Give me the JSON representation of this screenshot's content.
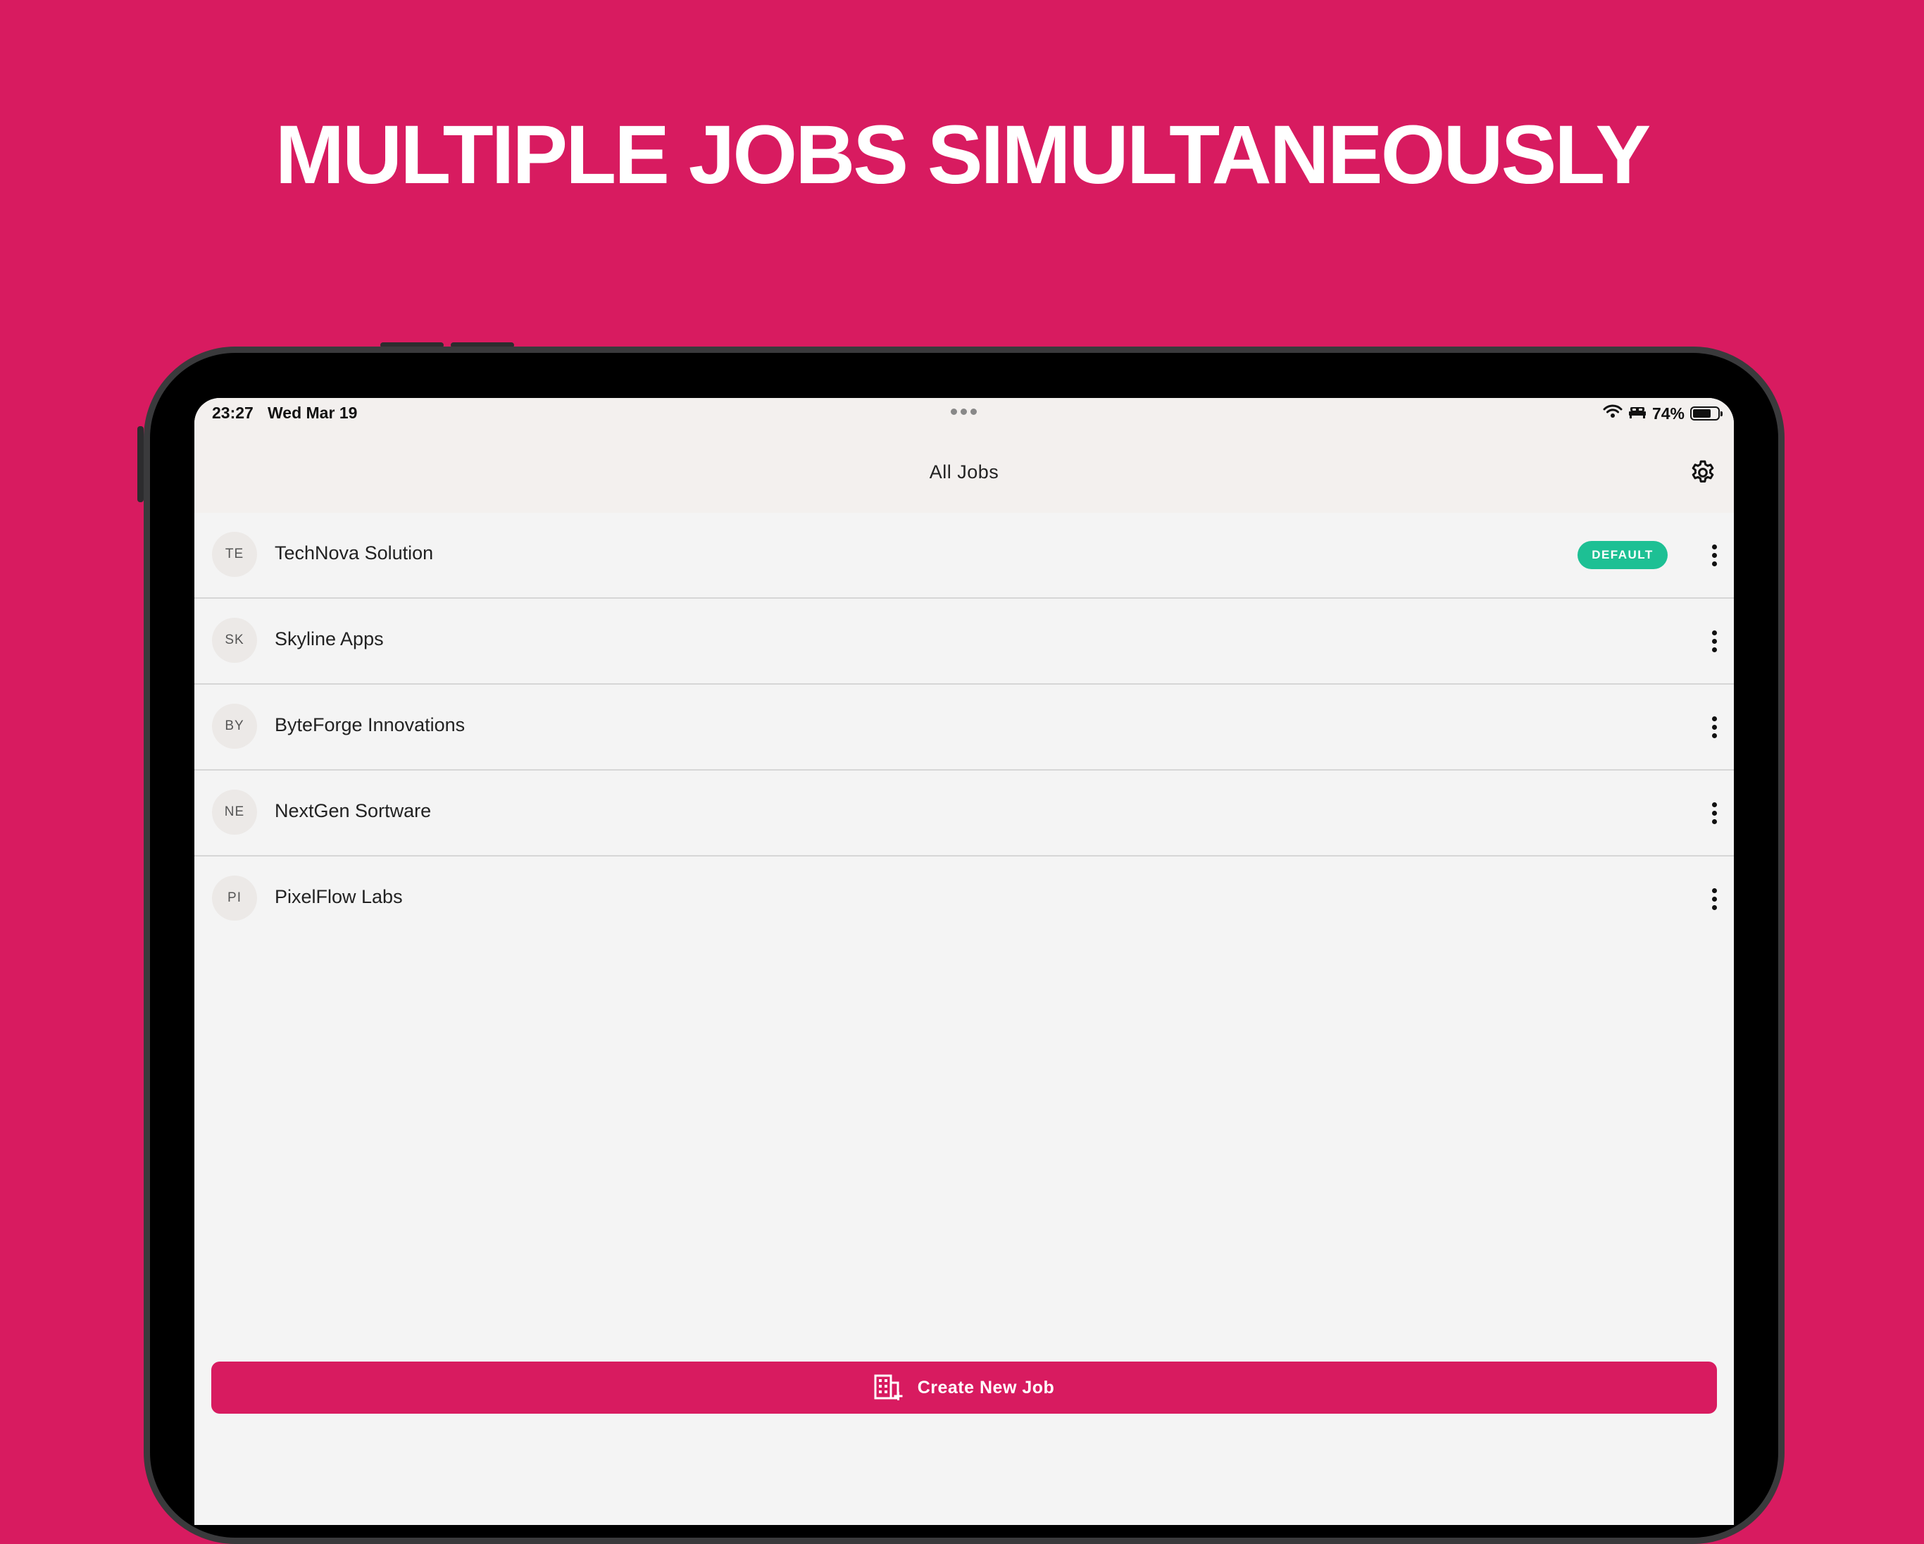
{
  "headline": "MULTIPLE JOBS SIMULTANEOUSLY",
  "status_bar": {
    "time": "23:27",
    "date": "Wed Mar 19",
    "battery_text": "74%",
    "battery_level": 0.74,
    "icons": [
      "wifi-icon",
      "bed-icon",
      "battery-icon"
    ]
  },
  "header": {
    "title": "All Jobs",
    "settings_icon": "gear-icon"
  },
  "jobs": [
    {
      "initials": "TE",
      "name": "TechNova Solution",
      "badge": "DEFAULT"
    },
    {
      "initials": "SK",
      "name": "Skyline Apps"
    },
    {
      "initials": "BY",
      "name": "ByteForge Innovations"
    },
    {
      "initials": "NE",
      "name": "NextGen Sortware"
    },
    {
      "initials": "PI",
      "name": "PixelFlow Labs"
    }
  ],
  "create_button": {
    "label": "Create New Job",
    "icon": "building-add-icon"
  },
  "colors": {
    "brand": "#d81b60",
    "badge": "#1dc094",
    "header_bg": "#f3f0ee",
    "list_bg": "#f4f4f4"
  }
}
